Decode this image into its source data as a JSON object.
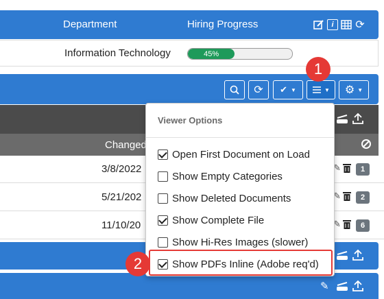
{
  "top_header": {
    "department_label": "Department",
    "hiring_label": "Hiring Progress",
    "icons": [
      "edit-icon",
      "info-icon",
      "grid-icon",
      "refresh-icon"
    ]
  },
  "info_row": {
    "department_value": "Information Technology",
    "progress_percent": 45,
    "progress_label": "45%"
  },
  "toolbar": {
    "search": "search-icon",
    "refresh": "refresh-icon",
    "check_dropdown": "checkmark-icon",
    "menu_dropdown": "menu-icon",
    "settings_dropdown": "gear-icon"
  },
  "documents_table": {
    "changed_header": "Changed",
    "rows": [
      {
        "date": "3/8/2022",
        "badge": "1"
      },
      {
        "date": "5/21/202",
        "badge": "2"
      },
      {
        "date": "11/10/20",
        "badge": "6"
      }
    ]
  },
  "viewer_options": {
    "title": "Viewer Options",
    "items": [
      {
        "label": "Open First Document on Load",
        "checked": true
      },
      {
        "label": "Show Empty Categories",
        "checked": false
      },
      {
        "label": "Show Deleted Documents",
        "checked": false
      },
      {
        "label": "Show Complete File",
        "checked": true
      },
      {
        "label": "Show Hi-Res Images (slower)",
        "checked": false
      },
      {
        "label": "Show PDFs Inline (Adobe req'd)",
        "checked": true
      }
    ]
  },
  "markers": {
    "one": "1",
    "two": "2"
  },
  "colors": {
    "header_blue": "#2f7bd1",
    "table_gray": "#6b6b6b",
    "progress_green": "#1e9a5a",
    "highlight_red": "#e53935"
  }
}
